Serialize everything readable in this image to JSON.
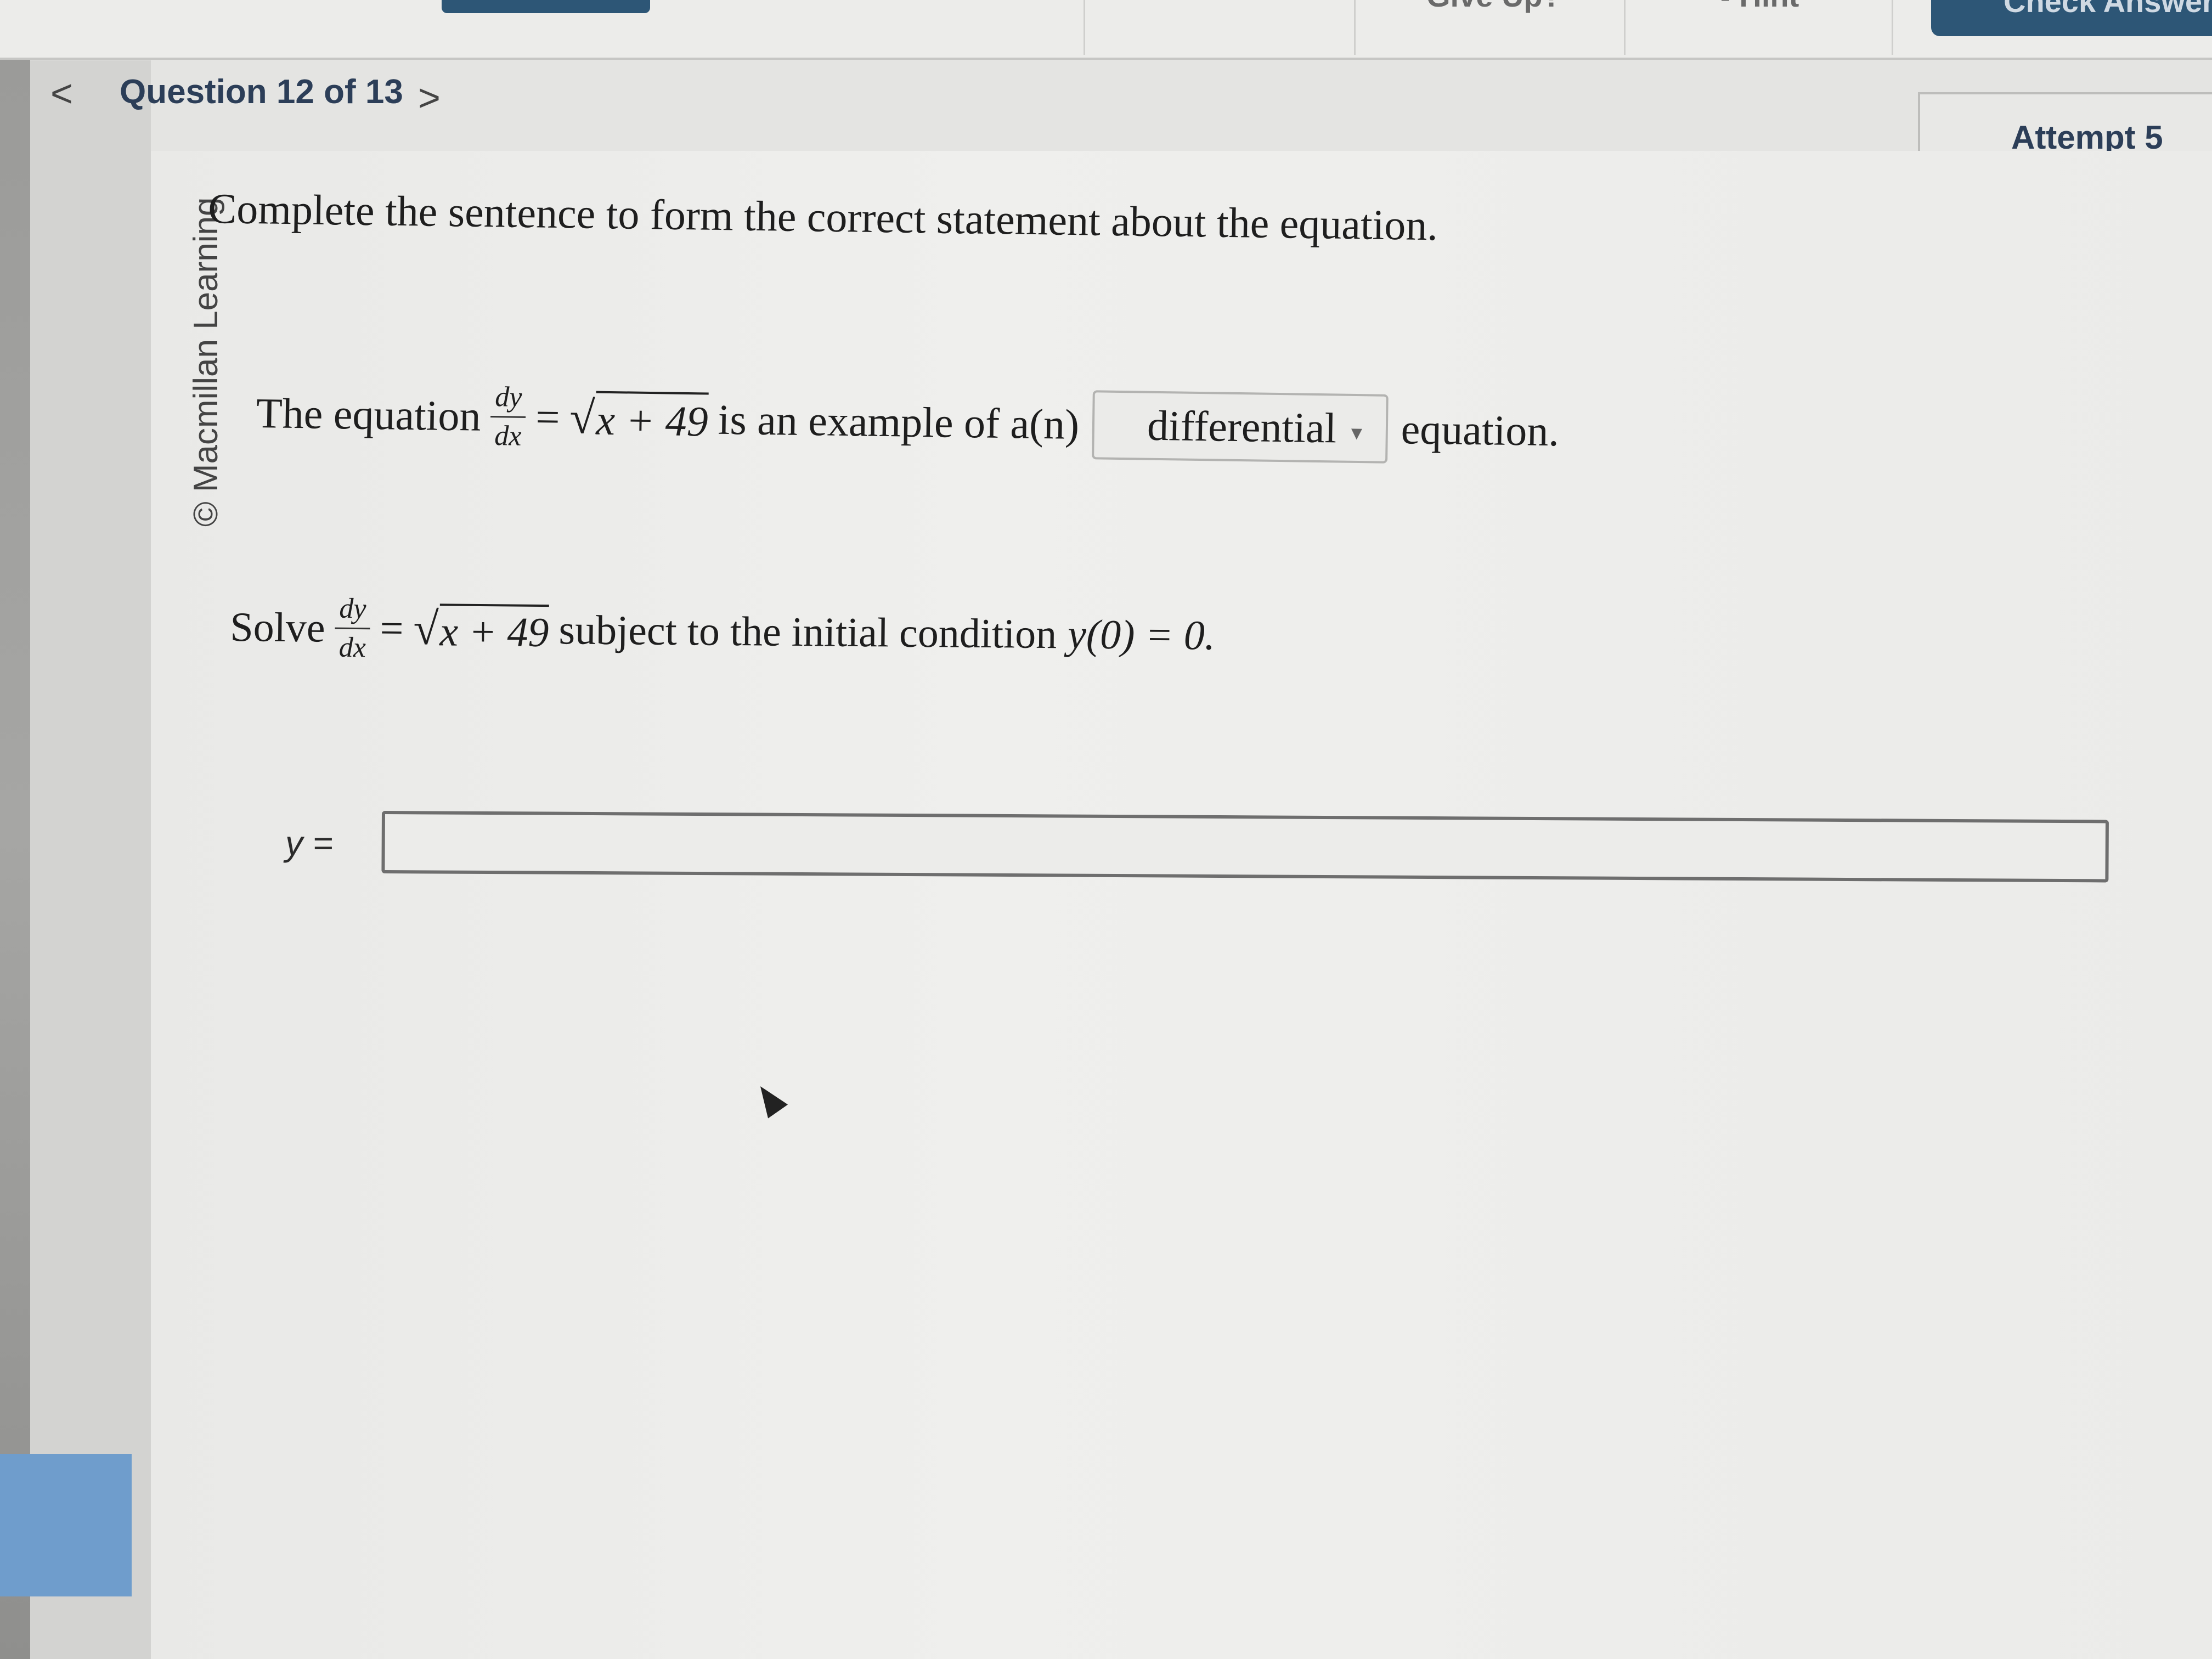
{
  "toolbar": {
    "give_up_label": "Give Up?",
    "hint_label": "Hint",
    "check_answer_label": "Check Answer"
  },
  "nav": {
    "prev_icon": "chevron-left",
    "question_label": "Question 12 of 13",
    "next_icon": "chevron-right"
  },
  "attempt_label": "Attempt 5",
  "credit": "© Macmillan Learning",
  "question": {
    "instruction": "Complete the sentence to form the correct statement about the equation.",
    "sentence_prefix": "The equation",
    "frac_num": "dy",
    "frac_den": "dx",
    "equals": "=",
    "radicand": "x + 49",
    "sentence_middle": "is an example of a(n)",
    "dropdown_value": "differential",
    "sentence_suffix": "equation.",
    "solve_prefix": "Solve",
    "solve_suffix": "subject to the initial condition",
    "initial_condition": "y(0) = 0.",
    "answer_label": "y =",
    "answer_value": ""
  }
}
